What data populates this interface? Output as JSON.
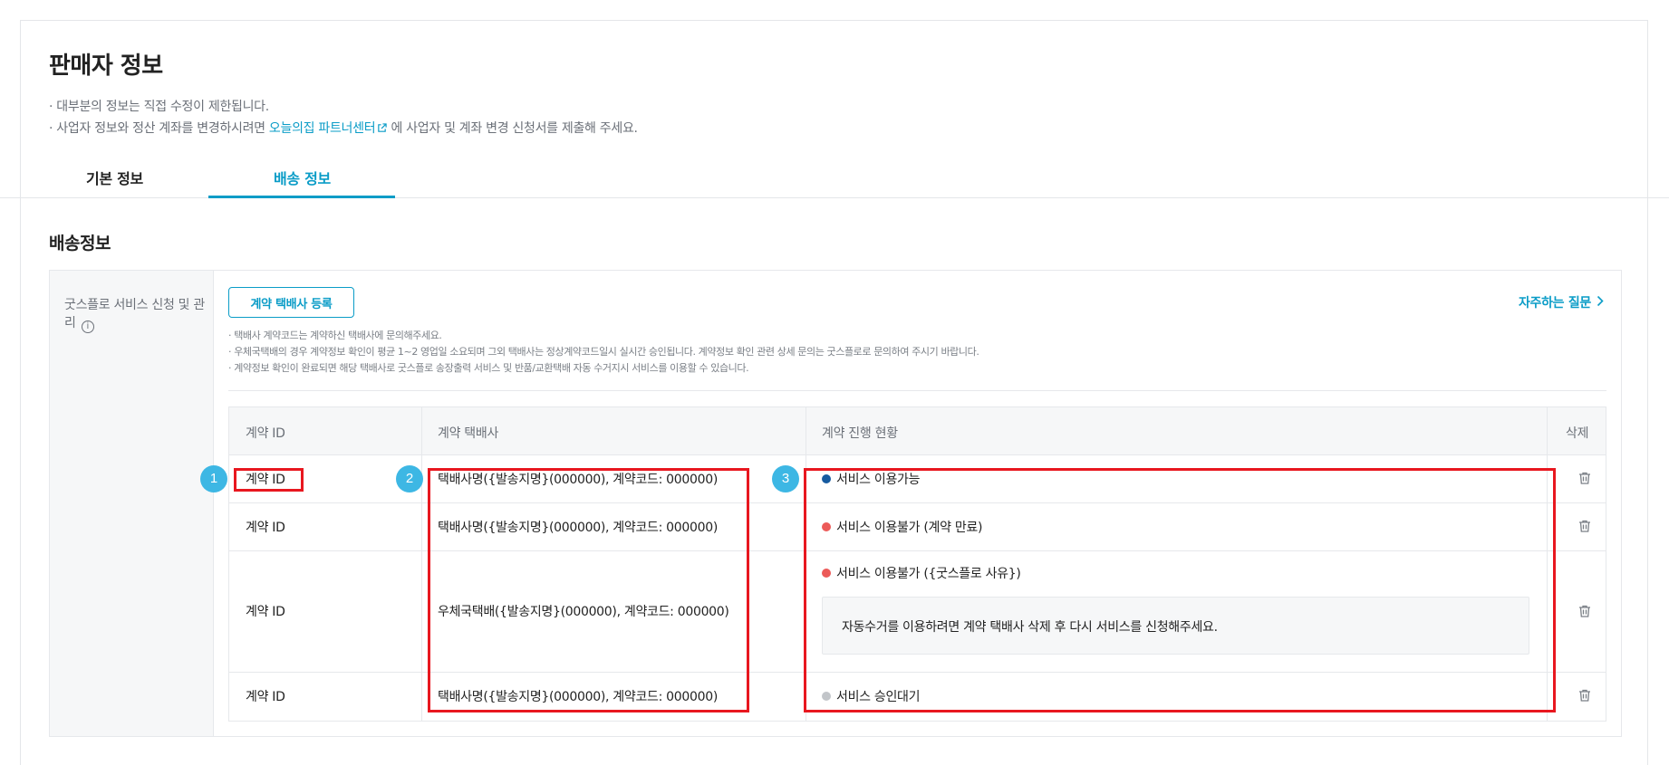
{
  "header": {
    "title": "판매자 정보",
    "notice_1": "· 대부분의 정보는 직접 수정이 제한됩니다.",
    "notice_2_before": "· 사업자 정보와 정산 계좌를 변경하시려면 ",
    "notice_2_link": "오늘의집 파트너센터",
    "notice_2_after": " 에 사업자 및 계좌 변경 신청서를 제출해 주세요."
  },
  "tabs": [
    {
      "label": "기본 정보",
      "active": false
    },
    {
      "label": "배송 정보",
      "active": true
    }
  ],
  "section": {
    "title": "배송정보",
    "side_label": "굿스플로 서비스 신청 및 관리",
    "register_button": "계약 택배사 등록",
    "faq_link": "자주하는 질문",
    "guides": [
      "· 택배사 계약코드는 계약하신 택배사에 문의해주세요.",
      "· 우체국택배의 경우 계약정보 확인이 평균 1~2 영업일 소요되며 그외 택배사는 정상계약코드일시 실시간 승인됩니다. 계약정보 확인 관련 상세 문의는 굿스플로로 문의하여 주시기 바랍니다.",
      "· 계약정보 확인이 완료되면 해당 택배사로 굿스플로 송장출력 서비스 및 반품/교환택배 자동 수거지시 서비스를 이용할 수 있습니다."
    ]
  },
  "table": {
    "columns": [
      "계약 ID",
      "계약 택배사",
      "계약 진행 현황",
      "삭제"
    ],
    "rows": [
      {
        "id": "계약 ID",
        "courier": "택배사명({발송지명}(000000), 계약코드: 000000)",
        "status": "서비스 이용가능",
        "status_color": "#175ba0",
        "note": ""
      },
      {
        "id": "계약 ID",
        "courier": "택배사명({발송지명}(000000), 계약코드: 000000)",
        "status": "서비스 이용불가 (계약 만료)",
        "status_color": "#ec5a58",
        "note": ""
      },
      {
        "id": "계약 ID",
        "courier": "우체국택배({발송지명}(000000), 계약코드: 000000)",
        "status": "서비스 이용불가 ({굿스플로 사유})",
        "status_color": "#ec5a58",
        "note": "자동수거를 이용하려면 계약 택배사 삭제 후 다시 서비스를 신청해주세요."
      },
      {
        "id": "계약 ID",
        "courier": "택배사명({발송지명}(000000), 계약코드: 000000)",
        "status": "서비스 승인대기",
        "status_color": "#c2c5c9",
        "note": ""
      }
    ]
  },
  "annotations": {
    "badges": [
      "1",
      "2",
      "3"
    ],
    "highlight_color": "#e8171f",
    "badge_color": "#3db7e4"
  },
  "colors": {
    "accent": "#0a9cc7",
    "border": "#e6e8eb",
    "muted_text": "#6b7078"
  }
}
